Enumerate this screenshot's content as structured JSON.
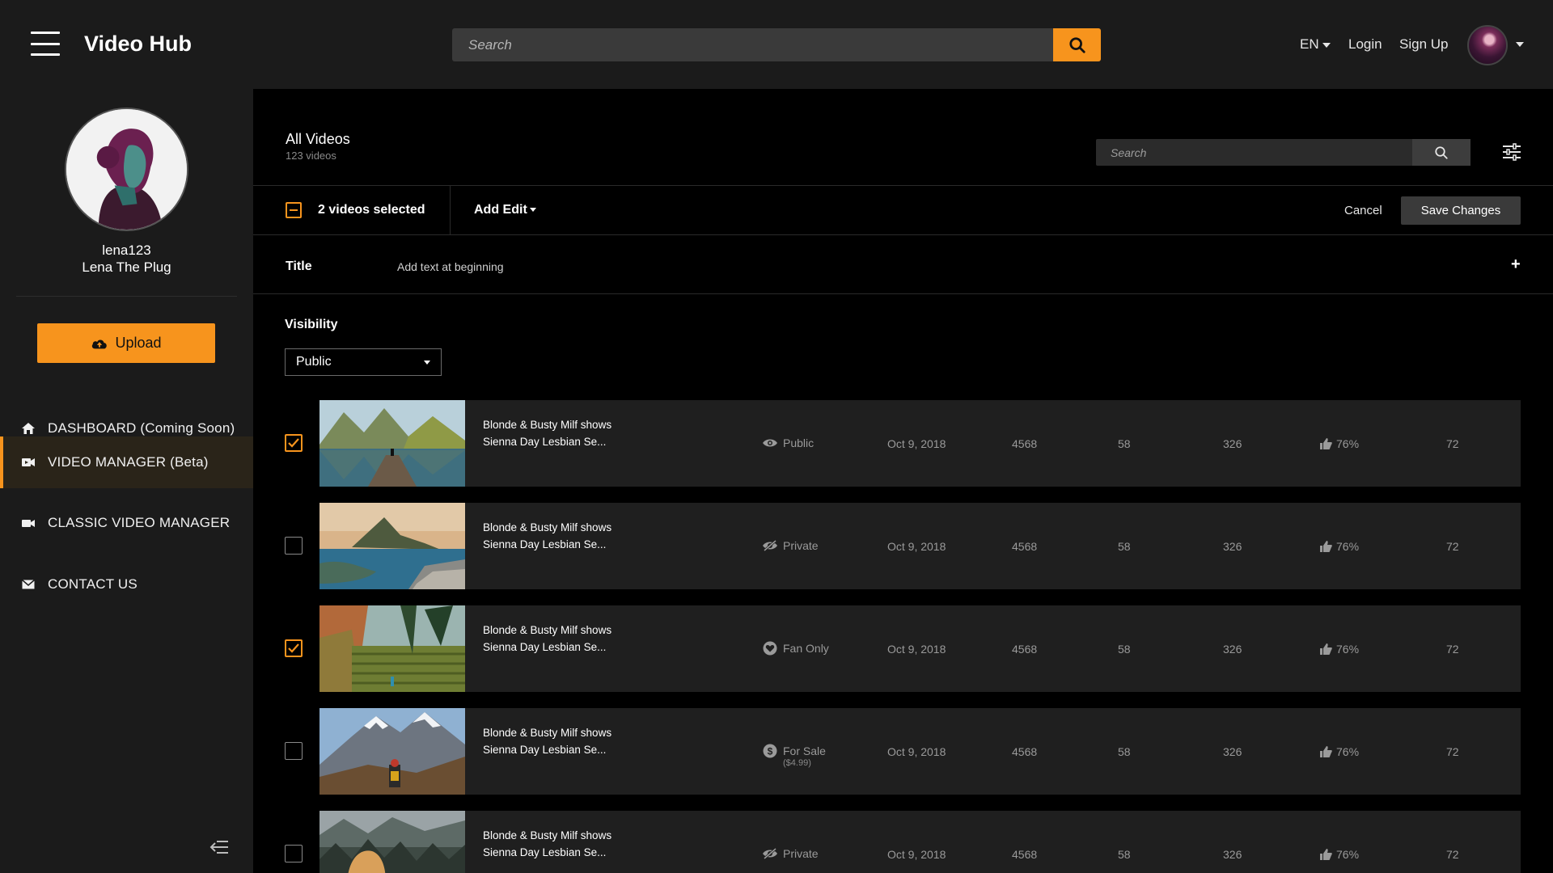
{
  "header": {
    "menu_icon": "hamburger-menu-icon",
    "app_title": "Video Hub",
    "search_placeholder": "Search",
    "search_icon": "search-icon",
    "language": "EN",
    "login": "Login",
    "signup": "Sign Up",
    "accent_color": "#f7941d"
  },
  "sidebar": {
    "username": "lena123",
    "display_name": "Lena The Plug",
    "upload_label": "Upload",
    "nav": [
      {
        "label": "DASHBOARD (Coming Soon)",
        "icon": "home-icon",
        "active": false
      },
      {
        "label": "VIDEO MANAGER (Beta)",
        "icon": "video-manager-icon",
        "active": true
      },
      {
        "label": "CLASSIC VIDEO MANAGER",
        "icon": "camera-icon",
        "active": false
      },
      {
        "label": "CONTACT US",
        "icon": "envelope-icon",
        "active": false
      }
    ]
  },
  "main": {
    "title": "All Videos",
    "count": "123 videos",
    "search_placeholder": "Search",
    "toolbar": {
      "selected_text": "2 videos selected",
      "add_edit": "Add Edit",
      "cancel": "Cancel",
      "save": "Save Changes"
    },
    "title_edit": {
      "label": "Title",
      "action": "Add text at beginning",
      "plus": "+"
    },
    "visibility": {
      "label": "Visibility",
      "selected": "Public"
    },
    "videos": [
      {
        "checked": true,
        "thumb": "lake-mountains",
        "title_line1": "Blonde & Busty Milf shows",
        "title_line2": "Sienna Day Lesbian Se...",
        "visibility": "Public",
        "visibility_icon": "eye-icon",
        "visibility_sub": "",
        "date": "Oct 9, 2018",
        "views": "4568",
        "col_a": "58",
        "col_b": "326",
        "rating": "76%",
        "col_c": "72"
      },
      {
        "checked": false,
        "thumb": "coastal-bay",
        "title_line1": "Blonde & Busty Milf shows",
        "title_line2": "Sienna Day Lesbian Se...",
        "visibility": "Private",
        "visibility_icon": "eye-slash-icon",
        "visibility_sub": "",
        "date": "Oct 9, 2018",
        "views": "4568",
        "col_a": "58",
        "col_b": "326",
        "rating": "76%",
        "col_c": "72"
      },
      {
        "checked": true,
        "thumb": "jungle-terraces",
        "title_line1": "Blonde & Busty Milf shows",
        "title_line2": "Sienna Day Lesbian Se...",
        "visibility": "Fan Only",
        "visibility_icon": "heart-icon",
        "visibility_sub": "",
        "date": "Oct 9, 2018",
        "views": "4568",
        "col_a": "58",
        "col_b": "326",
        "rating": "76%",
        "col_c": "72"
      },
      {
        "checked": false,
        "thumb": "snowy-peaks",
        "title_line1": "Blonde & Busty Milf shows",
        "title_line2": "Sienna Day Lesbian Se...",
        "visibility": "For Sale",
        "visibility_icon": "dollar-icon",
        "visibility_sub": "($4.99)",
        "date": "Oct 9, 2018",
        "views": "4568",
        "col_a": "58",
        "col_b": "326",
        "rating": "76%",
        "col_c": "72"
      },
      {
        "checked": false,
        "thumb": "misty-forest",
        "title_line1": "Blonde & Busty Milf shows",
        "title_line2": "Sienna Day Lesbian Se...",
        "visibility": "Private",
        "visibility_icon": "eye-slash-icon",
        "visibility_sub": "",
        "date": "Oct 9, 2018",
        "views": "4568",
        "col_a": "58",
        "col_b": "326",
        "rating": "76%",
        "col_c": "72"
      }
    ]
  }
}
